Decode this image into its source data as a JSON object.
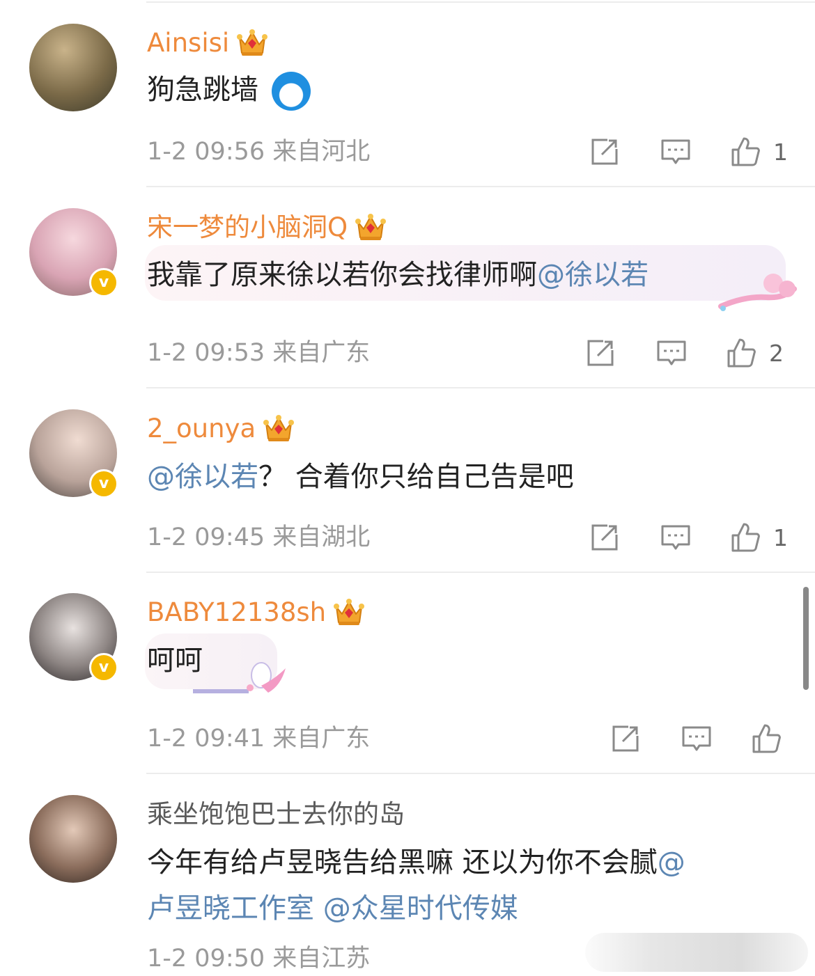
{
  "comments": [
    {
      "username": "Ainsisi",
      "crown_level": "6",
      "text": "狗急跳墙",
      "emoji": "doraemon-emoji",
      "timestamp": "1-2 09:56",
      "location": "来自河北",
      "like_count": "1"
    },
    {
      "username": "宋一梦的小脑洞Q",
      "crown_level": "6",
      "text": "我靠了原来徐以若你会找律师啊",
      "mention": "@徐以若",
      "timestamp": "1-2 09:53",
      "location": "来自广东",
      "like_count": "2",
      "verified": true
    },
    {
      "username": "2_ounya",
      "crown_level": "4",
      "mention": "@徐以若",
      "text": "？ 合着你只给自己告是吧",
      "timestamp": "1-2 09:45",
      "location": "来自湖北",
      "like_count": "1",
      "verified": true
    },
    {
      "username": "BABY12138sh",
      "crown_level": "7",
      "text": "呵呵",
      "timestamp": "1-2 09:41",
      "location": "来自广东",
      "like_count": "",
      "verified": true
    },
    {
      "username": "乘坐饱饱巴士去你的岛",
      "text_line1": "今年有给卢昱晓告给黑嘛 还以为你不会腻",
      "mention_1a": "@",
      "mention_1b": "卢昱晓工作室",
      "mention_2": "@众星时代传媒",
      "timestamp": "1-2 09:50",
      "location": "来自江苏"
    }
  ],
  "colors": {
    "username": "#ee8a3c",
    "mention": "#5c86b3",
    "meta": "#9a9a9a",
    "verified_badge": "#f5b800"
  },
  "icons": [
    "share-icon",
    "comment-icon",
    "like-icon",
    "crown-icon",
    "verified-icon"
  ]
}
